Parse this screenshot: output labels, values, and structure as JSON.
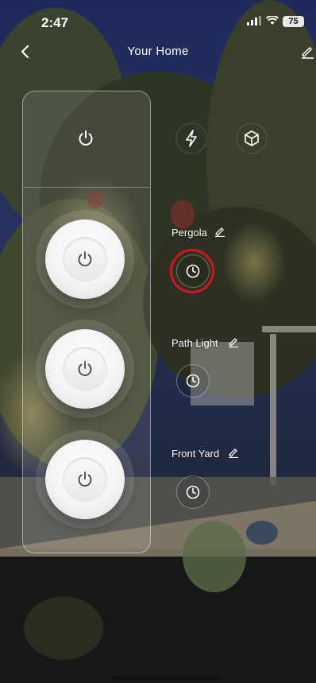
{
  "status_bar": {
    "time": "2:47",
    "battery": "75"
  },
  "nav": {
    "title": "Your Home"
  },
  "scenes": [
    {
      "label": "Pergola"
    },
    {
      "label": "Path Light"
    },
    {
      "label": "Front Yard"
    }
  ],
  "colors": {
    "highlight_ring": "#d8141b",
    "text": "#ffffff",
    "button_face": "#f4f4f4"
  },
  "icons": [
    "back-chevron-icon",
    "edit-pencil-icon",
    "power-icon",
    "lightning-icon",
    "cube-icon",
    "clock-icon"
  ]
}
